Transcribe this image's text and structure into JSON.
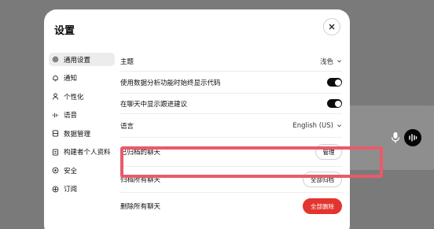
{
  "modal": {
    "title": "设置",
    "close_icon": "close-icon"
  },
  "sidebar": {
    "items": [
      {
        "label": "通用设置",
        "icon": "gear-icon",
        "active": true
      },
      {
        "label": "通知",
        "icon": "bell-icon"
      },
      {
        "label": "个性化",
        "icon": "person-icon"
      },
      {
        "label": "语音",
        "icon": "waveform-icon"
      },
      {
        "label": "数据管理",
        "icon": "database-icon"
      },
      {
        "label": "构建者个人资料",
        "icon": "profile-card-icon"
      },
      {
        "label": "安全",
        "icon": "shield-icon"
      },
      {
        "label": "订阅",
        "icon": "subscription-icon"
      }
    ]
  },
  "settings": {
    "theme_label": "主题",
    "theme_value": "浅色",
    "code_label": "使用数据分析功能时始终显示代码",
    "code_toggle_on": true,
    "suggest_label": "在聊天中显示跟进建议",
    "suggest_toggle_on": true,
    "language_label": "语言",
    "language_value": "English (US)",
    "archived_label": "已归档的聊天",
    "archived_button": "管理",
    "archive_all_label": "归档所有聊天",
    "archive_all_button": "全部归档",
    "delete_all_label": "删除所有聊天",
    "delete_all_button": "全部删除"
  },
  "colors": {
    "danger": "#e3342f",
    "highlight": "#ea5a6a",
    "toggle_on": "#0d0d0d"
  }
}
